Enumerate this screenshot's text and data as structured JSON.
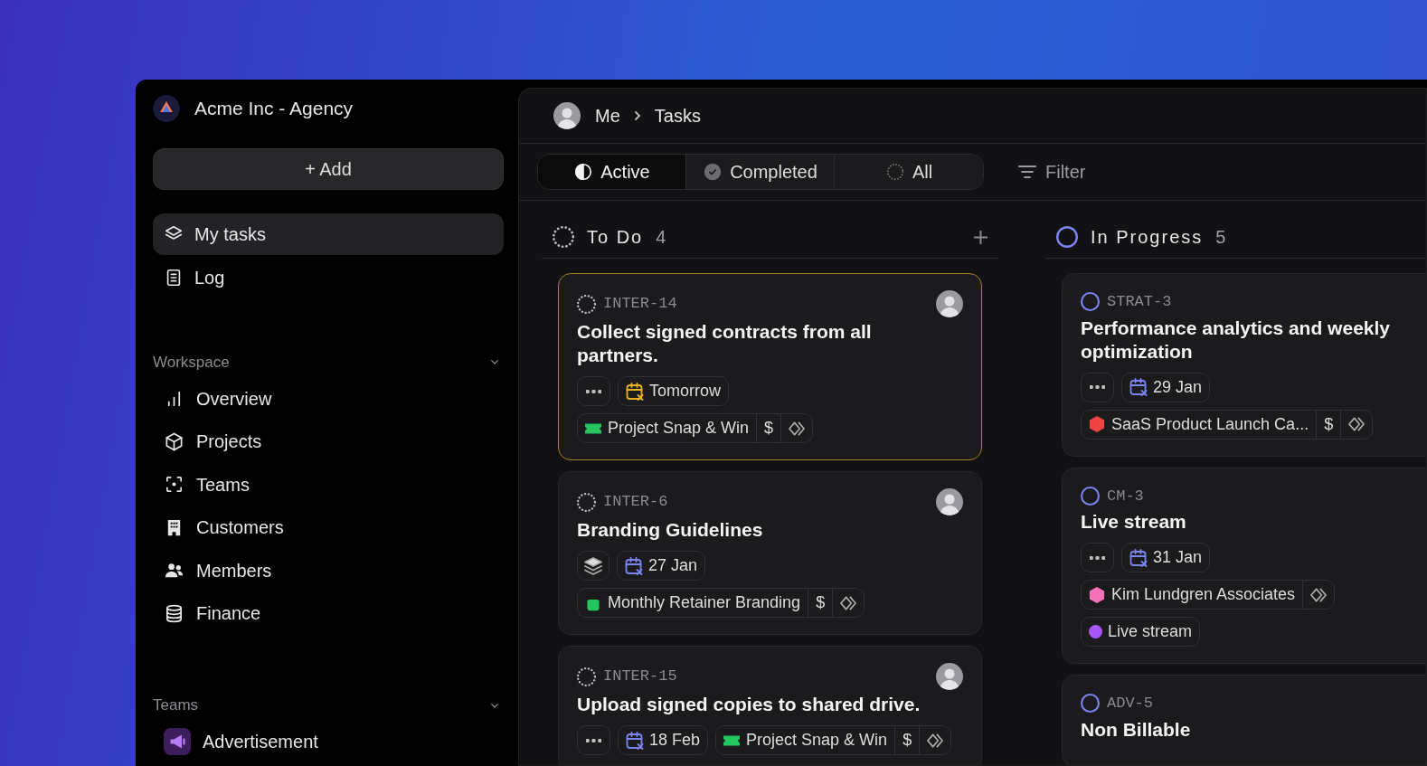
{
  "workspace": {
    "name": "Acme Inc - Agency"
  },
  "add_button": "+ Add",
  "nav": [
    {
      "label": "My tasks",
      "selected": true
    },
    {
      "label": "Log",
      "selected": false
    }
  ],
  "sections": [
    {
      "title": "Workspace",
      "expanded": true,
      "items": [
        {
          "label": "Overview"
        },
        {
          "label": "Projects"
        },
        {
          "label": "Teams"
        },
        {
          "label": "Customers"
        },
        {
          "label": "Members"
        },
        {
          "label": "Finance"
        }
      ]
    },
    {
      "title": "Teams",
      "expanded": true,
      "items": [
        {
          "label": "Advertisement"
        }
      ]
    }
  ],
  "breadcrumb": [
    "Me",
    "Tasks"
  ],
  "filter_tabs": [
    {
      "label": "Active",
      "selected": true
    },
    {
      "label": "Completed",
      "selected": false
    },
    {
      "label": "All",
      "selected": false
    }
  ],
  "filter_button": "Filter",
  "columns": [
    {
      "title": "To Do",
      "count": "4",
      "kind": "todo",
      "show_add": true,
      "tasks": [
        {
          "id": "INTER-14",
          "title": "Collect signed contracts from all partners.",
          "highlighted": true,
          "avatar": true,
          "kind": "more",
          "due": {
            "label": "Tomorrow",
            "color": "#e9b021"
          },
          "project": {
            "name": "Project Snap & Win",
            "kind": "ticket",
            "color": "#22c55e",
            "billing": "$"
          }
        },
        {
          "id": "INTER-6",
          "title": "Branding Guidelines",
          "highlighted": false,
          "avatar": true,
          "kind": "stack",
          "due": {
            "label": "27 Jan",
            "color": "#7d84f2"
          },
          "project": {
            "name": "Monthly Retainer Branding",
            "kind": "bag",
            "color": "#22c55e",
            "billing": "$"
          }
        },
        {
          "id": "INTER-15",
          "title": "Upload signed copies to shared drive.",
          "highlighted": false,
          "avatar": true,
          "kind": "more",
          "inline": true,
          "due": {
            "label": "18 Feb",
            "color": "#7d84f2"
          },
          "project": {
            "name": "Project Snap & Win",
            "kind": "ticket",
            "color": "#22c55e",
            "billing": "$"
          }
        }
      ]
    },
    {
      "title": "In Progress",
      "count": "5",
      "kind": "progress",
      "show_add": false,
      "tasks": [
        {
          "id": "STRAT-3",
          "title": "Performance analytics and weekly optimization",
          "highlighted": false,
          "avatar": false,
          "kind": "more",
          "due": {
            "label": "29 Jan",
            "color": "#7d84f2"
          },
          "project": {
            "name": "SaaS Product Launch Ca...",
            "kind": "cube",
            "color": "#ef4444",
            "billing": "$"
          }
        },
        {
          "id": "CM-3",
          "title": "Live stream",
          "highlighted": false,
          "avatar": false,
          "kind": "more",
          "due": {
            "label": "31 Jan",
            "color": "#7d84f2"
          },
          "project": {
            "name": "Kim Lundgren Associates",
            "kind": "cube",
            "color": "#f472b6"
          },
          "labels": [
            {
              "name": "Live stream",
              "color": "#a855f7"
            }
          ]
        },
        {
          "id": "ADV-5",
          "title": "Non Billable",
          "highlighted": false,
          "avatar": false
        }
      ]
    }
  ]
}
